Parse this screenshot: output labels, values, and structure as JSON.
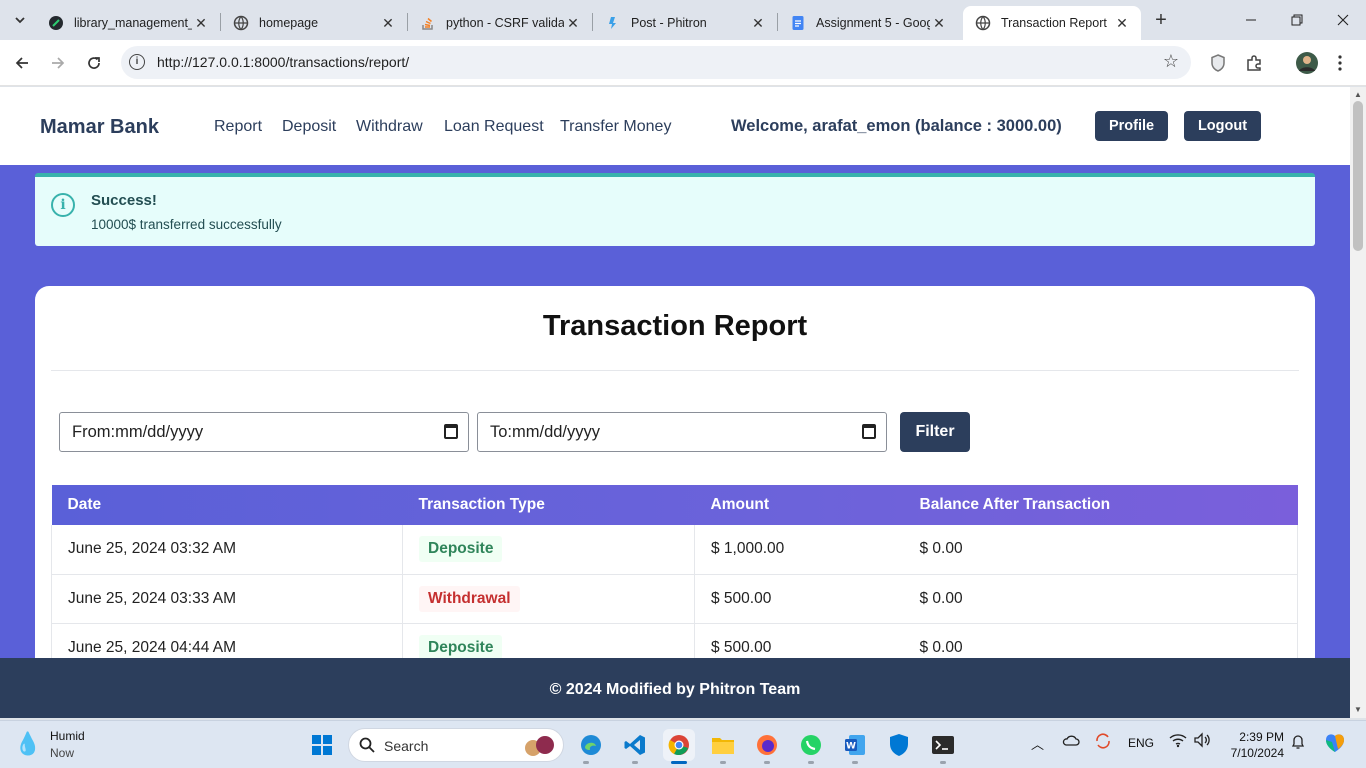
{
  "browser": {
    "tabs": [
      {
        "title": "library_management_",
        "icon": "github-icon"
      },
      {
        "title": "homepage",
        "icon": "globe-icon"
      },
      {
        "title": "python - CSRF validat",
        "icon": "stackoverflow-icon"
      },
      {
        "title": "Post - Phitron",
        "icon": "phitron-icon"
      },
      {
        "title": "Assignment 5 - Goog",
        "icon": "google-docs-icon"
      },
      {
        "title": "Transaction Report",
        "icon": "globe-icon"
      }
    ],
    "url": "http://127.0.0.1:8000/transactions/report/"
  },
  "navbar": {
    "brand": "Mamar Bank",
    "links": [
      "Report",
      "Deposit",
      "Withdraw",
      "Loan Request",
      "Transfer Money"
    ],
    "welcome": "Welcome, arafat_emon (balance : 3000.00)",
    "profile_label": "Profile",
    "logout_label": "Logout"
  },
  "alert": {
    "title": "Success!",
    "message": "10000$ transferred successfully",
    "accent": "#38b2ac"
  },
  "report": {
    "title": "Transaction Report",
    "from_placeholder": "From:mm/dd/yyyy",
    "to_placeholder": "To:mm/dd/yyyy",
    "filter_label": "Filter",
    "columns": [
      "Date",
      "Transaction Type",
      "Amount",
      "Balance After Transaction"
    ],
    "rows": [
      {
        "date": "June 25, 2024 03:32 AM",
        "type": "Deposite",
        "kind": "deposit",
        "amount": "$ 1,000.00",
        "balance": "$ 0.00"
      },
      {
        "date": "June 25, 2024 03:33 AM",
        "type": "Withdrawal",
        "kind": "withdraw",
        "amount": "$ 500.00",
        "balance": "$ 0.00"
      },
      {
        "date": "June 25, 2024 04:44 AM",
        "type": "Deposite",
        "kind": "deposit",
        "amount": "$ 500.00",
        "balance": "$ 0.00"
      }
    ]
  },
  "footer": {
    "text": "© 2024 Modified by Phitron Team"
  },
  "taskbar": {
    "weather_title": "Humid",
    "weather_sub": "Now",
    "search_placeholder": "Search",
    "lang": "ENG",
    "time": "2:39 PM",
    "date": "7/10/2024"
  },
  "colors": {
    "page_bg": "#5a60d8",
    "navy": "#2c3e5c",
    "deposit": "#2f855a",
    "withdraw": "#c53030"
  }
}
